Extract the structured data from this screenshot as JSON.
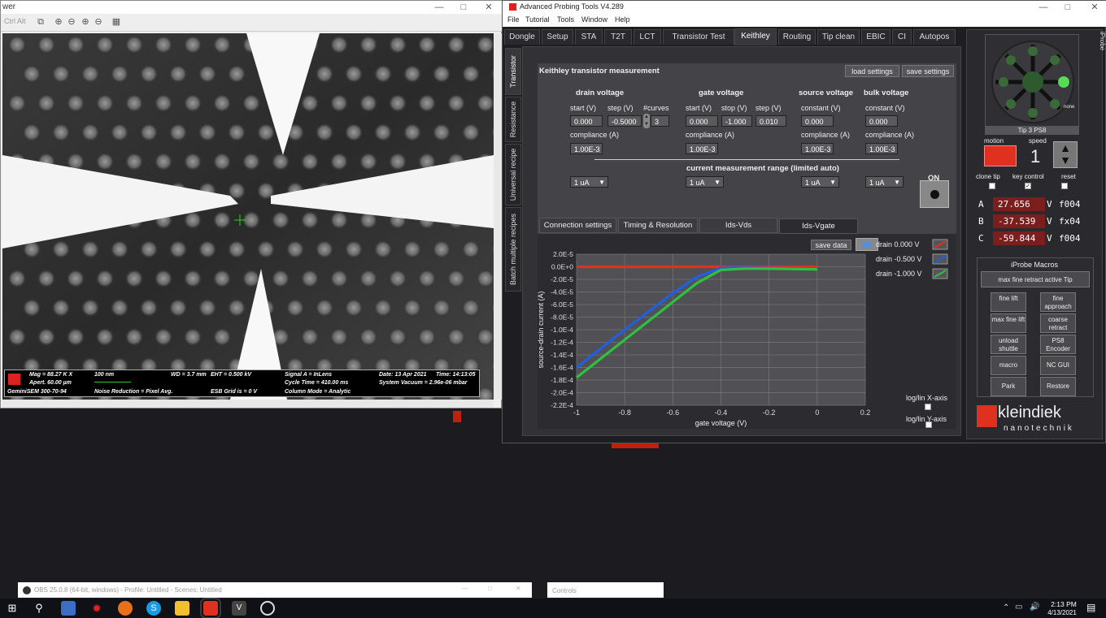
{
  "sem": {
    "title": "wer",
    "toolbar_hint": "Ctrl  Alt",
    "info": {
      "mag": "Mag = 88.27 K X",
      "aperture": "Apert.   60.00 µm",
      "scale": "100 nm",
      "device": "GeminiSEM 300-70-94",
      "wd": "WD =  3.7 mm",
      "noise": "Noise Reduction = Pixel Avg.",
      "eht": "EHT = 0.500 kV",
      "esb": "ESB Grid is =      0 V",
      "signal": "Signal A = InLens",
      "cycle": "Cycle Time = 410.00 ms",
      "column": "Column Mode = Analytic",
      "date": "Date: 13 Apr 2021",
      "time": "Time: 14:13:05",
      "vacuum": "System Vacuum = 2.96e-06 mbar"
    }
  },
  "apt": {
    "title": "Advanced Probing Tools V4.289",
    "menu": [
      "File",
      "Tutorial",
      "Tools",
      "Window",
      "Help"
    ],
    "tabs": [
      "Dongle",
      "Setup",
      "STA",
      "T2T",
      "LCT",
      "Transistor Test",
      "Keithley",
      "Routing",
      "Tip clean",
      "EBIC",
      "CI",
      "Autopos"
    ],
    "side_tabs": [
      "Transistor",
      "Resistance",
      "Universal recipe",
      "Batch multiple recipes"
    ],
    "iprobe_label": "iProbe",
    "keithley": {
      "title": "Keithley transistor measurement",
      "load_btn": "load settings",
      "save_btn": "save settings",
      "drain": {
        "label": "drain voltage",
        "start_label": "start (V)",
        "step_label": "step (V)",
        "curves_label": "#curves",
        "start": "0.000",
        "step": "-0.5000",
        "curves": "3",
        "comp_label": "compliance (A)",
        "comp": "1.00E-3",
        "range": "1 uA"
      },
      "gate": {
        "label": "gate voltage",
        "start_label": "start (V)",
        "stop_label": "stop (V)",
        "step_label": "step (V)",
        "start": "0.000",
        "stop": "-1.000",
        "step": "0.010",
        "comp_label": "compliance (A)",
        "comp": "1.00E-3",
        "range": "1 uA"
      },
      "source": {
        "label": "source voltage",
        "const_label": "constant (V)",
        "value": "0.000",
        "comp_label": "compliance (A)",
        "comp": "1.00E-3",
        "range": "1 uA"
      },
      "bulk": {
        "label": "bulk voltage",
        "const_label": "constant (V)",
        "value": "0.000",
        "comp_label": "compliance (A)",
        "comp": "1.00E-3",
        "range": "1 uA"
      },
      "range_title": "current measurement range (limited auto)",
      "on_label": "ON",
      "subtabs": [
        "Connection settings",
        "Timing & Resolution",
        "Ids-Vds",
        "Ids-Vgate"
      ],
      "save_data": "save data",
      "loglin_x": "log/lin X-axis",
      "loglin_y": "log/lin Y-axis"
    },
    "right": {
      "tip_label": "Tip 3 PS8",
      "none_label": "none",
      "motion_label": "motion",
      "speed_label": "speed",
      "speed_value": "1",
      "clone_tip": "clone tip",
      "key_control": "key control",
      "reset": "reset",
      "coords": [
        {
          "axis": "A",
          "value": "27.656",
          "unit": "V",
          "code": "f004"
        },
        {
          "axis": "B",
          "value": "-37.539",
          "unit": "V",
          "code": "fx04"
        },
        {
          "axis": "C",
          "value": "-59.844",
          "unit": "V",
          "code": "f004"
        }
      ],
      "macros_title": "iProbe Macros",
      "macro_wide": "max fine retract active Tip",
      "macro_buttons": [
        "fine lift",
        "fine approach",
        "max fine lift",
        "coarse retract",
        "unload shuttle",
        "PS8 Encoder",
        "macro",
        "NC GUI",
        "Park",
        "Restore"
      ],
      "brand_main": "kleindiek",
      "brand_sub": "nanotechnik"
    }
  },
  "chart_data": {
    "type": "line",
    "xlabel": "gate voltage (V)",
    "ylabel": "source-drain current (A)",
    "xlim": [
      -1,
      0.2
    ],
    "ylim": [
      -0.00022,
      2e-05
    ],
    "xticks": [
      "-1",
      "-0.8",
      "-0.6",
      "-0.4",
      "-0.2",
      "0",
      "0.2"
    ],
    "yticks": [
      "2.0E-5",
      "0.0E+0",
      "-2.0E-5",
      "-4.0E-5",
      "-6.0E-5",
      "-8.0E-5",
      "-1.0E-4",
      "-1.2E-4",
      "-1.4E-4",
      "-1.6E-4",
      "-1.8E-4",
      "-2.0E-4",
      "-2.2E-4"
    ],
    "series": [
      {
        "name": "drain 0.000 V",
        "color": "#e03020",
        "x": [
          -1,
          -0.6,
          -0.4,
          -0.2,
          0
        ],
        "y": [
          0,
          0,
          0,
          0,
          0
        ]
      },
      {
        "name": "drain -0.500 V",
        "color": "#2060e0",
        "x": [
          -1,
          -0.8,
          -0.6,
          -0.5,
          -0.4,
          -0.35,
          -0.2,
          0
        ],
        "y": [
          -0.00016,
          -0.0001,
          -4.2e-05,
          -1.6e-05,
          -2e-06,
          -1e-06,
          -2e-06,
          -3e-06
        ]
      },
      {
        "name": "drain -1.000 V",
        "color": "#30c040",
        "x": [
          -1,
          -0.8,
          -0.6,
          -0.5,
          -0.4,
          -0.3,
          -0.2,
          0
        ],
        "y": [
          -0.000176,
          -0.000116,
          -5.6e-05,
          -2.6e-05,
          -5e-06,
          -3e-06,
          -3e-06,
          -4e-06
        ]
      }
    ]
  },
  "obs_title": "OBS 25.0.8 (64-bit, windows) - Profile: Untitled - Scenes: Untitled",
  "controls_label": "Controls",
  "clock": {
    "time": "2:13 PM",
    "date": "4/13/2021"
  }
}
